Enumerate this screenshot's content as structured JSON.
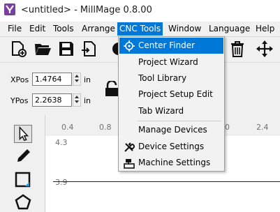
{
  "window": {
    "title": "<untitled> - MillMage 0.8.00"
  },
  "menubar": {
    "items": [
      "File",
      "Edit",
      "Tools",
      "Arrange",
      "CNC Tools",
      "Window",
      "Language",
      "Help"
    ],
    "active": "CNC Tools"
  },
  "toolbar": {
    "icons": [
      "new-file-icon",
      "open-folder-icon",
      "save-icon",
      "import-icon",
      "delete-icon",
      "move-icon"
    ]
  },
  "position": {
    "x_label": "XPos",
    "x_value": "1.4764",
    "x_unit": "in",
    "y_label": "YPos",
    "y_value": "2.2638",
    "y_unit": "in"
  },
  "ruler": {
    "x_ticks": [
      "0.4",
      "0.8",
      "0",
      "2.4"
    ],
    "y_ticks": [
      "4.3",
      "3.9"
    ]
  },
  "cnc_menu": {
    "items": [
      {
        "label": "Center Finder",
        "icon": "crosshair-icon",
        "highlighted": true
      },
      {
        "label": "Project Wizard"
      },
      {
        "label": "Tool Library"
      },
      {
        "label": "Project Setup Edit"
      },
      {
        "label": "Tab Wizard"
      },
      {
        "label": "Manage Devices"
      },
      {
        "label": "Device Settings",
        "icon": "wrench-screwdriver-icon"
      },
      {
        "label": "Machine Settings",
        "icon": "machine-icon"
      }
    ]
  },
  "colors": {
    "highlight": "#0078d7",
    "logo": "#7b3fa0"
  }
}
